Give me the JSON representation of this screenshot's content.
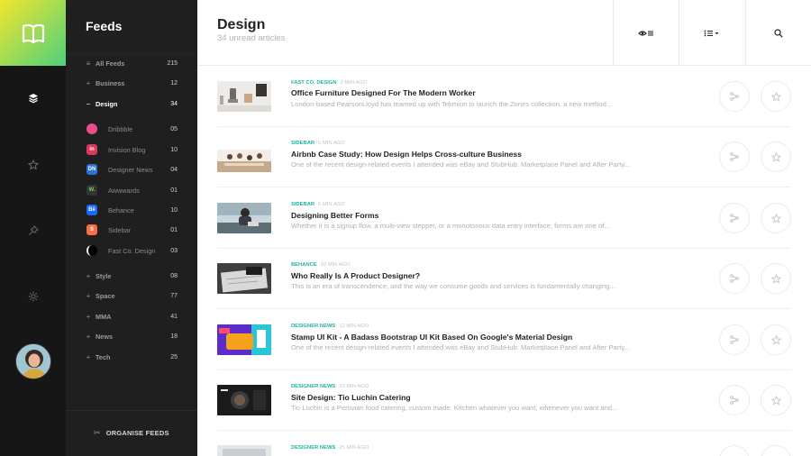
{
  "sidebar_rail": {
    "logo_icon": "book-icon",
    "nav": [
      {
        "name": "layers-icon",
        "active": true
      },
      {
        "name": "star-icon",
        "active": false
      },
      {
        "name": "pin-icon",
        "active": false
      },
      {
        "name": "gear-icon",
        "active": false
      }
    ]
  },
  "feeds": {
    "title": "Feeds",
    "all": {
      "label": "All Feeds",
      "count": "215"
    },
    "groups_top": [
      {
        "label": "Business",
        "count": "12"
      },
      {
        "label": "Design",
        "count": "34"
      }
    ],
    "sources": [
      {
        "label": "Dribbble",
        "count": "05",
        "color": "#ea4c89",
        "glyph": ""
      },
      {
        "label": "Invision Blog",
        "count": "10",
        "color": "#dc395f",
        "glyph": "in"
      },
      {
        "label": "Designer News",
        "count": "04",
        "color": "#2d72d9",
        "glyph": "DN"
      },
      {
        "label": "Awwwards",
        "count": "01",
        "color": "#333333",
        "glyph": "W."
      },
      {
        "label": "Behance",
        "count": "10",
        "color": "#1769ff",
        "glyph": "Bē"
      },
      {
        "label": "Sidebar",
        "count": "01",
        "color": "#f36f45",
        "glyph": "S"
      },
      {
        "label": "Fast Co. Design",
        "count": "03",
        "color": "#000000",
        "glyph": ""
      }
    ],
    "groups_bottom": [
      {
        "label": "Style",
        "count": "08"
      },
      {
        "label": "Space",
        "count": "77"
      },
      {
        "label": "MMA",
        "count": "41"
      },
      {
        "label": "News",
        "count": "18"
      },
      {
        "label": "Tech",
        "count": "25"
      }
    ],
    "organise_label": "ORGANISE FEEDS"
  },
  "header": {
    "title": "Design",
    "subtitle": "34 unread articles"
  },
  "articles": [
    {
      "source": "FAST CO. DESIGN",
      "ago": "2 MIN AGO",
      "title": "Office Furniture Designed For The Modern Worker",
      "excerpt": "London-based PearsonLloyd has teamed up with Tekmion to launch the Zones collection, a new method..."
    },
    {
      "source": "SIDEBAR",
      "ago": "5 MIN AGO",
      "title": "Airbnb Case Study: How Design Helps Cross-culture Business",
      "excerpt": "One of the recent design-related events I attended was eBay and StubHub: Marketplace Panel and After Party..."
    },
    {
      "source": "SIDEBAR",
      "ago": "6 MIN AGO",
      "title": "Designing Better Forms",
      "excerpt": "Whether it is a signup flow, a multi-view stepper, or a monotonous data entry interface, forms are one of..."
    },
    {
      "source": "BEHANCE",
      "ago": "10 MIN AGO",
      "title": "Who Really Is A Product Designer?",
      "excerpt": "This is an era of transcendence, and the way we consume goods and services is fundamentally changing..."
    },
    {
      "source": "DESIGNER NEWS",
      "ago": "12 MIN AGO",
      "title": "Stamp UI Kit - A Badass Bootstrap UI Kit Based On Google's Material Design",
      "excerpt": "One of the recent design-related events I attended was eBay and StubHub: Marketplace Panel and After Party..."
    },
    {
      "source": "DESIGNER NEWS",
      "ago": "22 MIN AGO",
      "title": "Site Design: Tio Luchin Catering",
      "excerpt": "Tio Luchin is a Peruvian food catering, custom made. Kitchen whatever you want, whenever you want and..."
    },
    {
      "source": "DESIGNER NEWS",
      "ago": "25 MIN AGO",
      "title": "",
      "excerpt": ""
    }
  ],
  "colors": {
    "accent": "#1fb5a0",
    "rail": "#161616",
    "panel": "#1f1f1f",
    "logo_from": "#f2e52c",
    "logo_to": "#4ed07d"
  }
}
